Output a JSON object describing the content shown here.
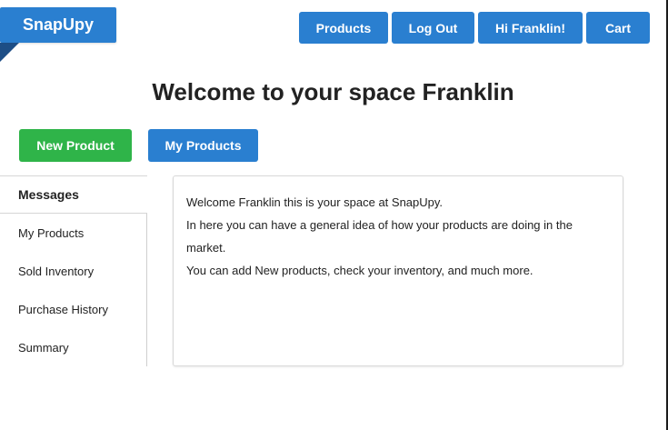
{
  "brand": {
    "name": "SnapUpy"
  },
  "nav": {
    "products": "Products",
    "logout": "Log Out",
    "greeting": "Hi Franklin!",
    "cart": "Cart"
  },
  "page": {
    "title": "Welcome to your space Franklin"
  },
  "actions": {
    "new_product": "New Product",
    "my_products": "My Products"
  },
  "sidebar": {
    "items": [
      {
        "label": "Messages",
        "active": true
      },
      {
        "label": "My Products"
      },
      {
        "label": "Sold Inventory"
      },
      {
        "label": "Purchase History"
      },
      {
        "label": "Summary"
      }
    ]
  },
  "content": {
    "lines": [
      "Welcome Franklin this is your space at SnapUpy.",
      "In here you can have a general idea of how your products are doing in the market.",
      "You can add New products, check your inventory, and much more."
    ]
  },
  "colors": {
    "primary": "#2a7fd0",
    "primary_dark": "#1d4e86",
    "success": "#2fb449"
  }
}
